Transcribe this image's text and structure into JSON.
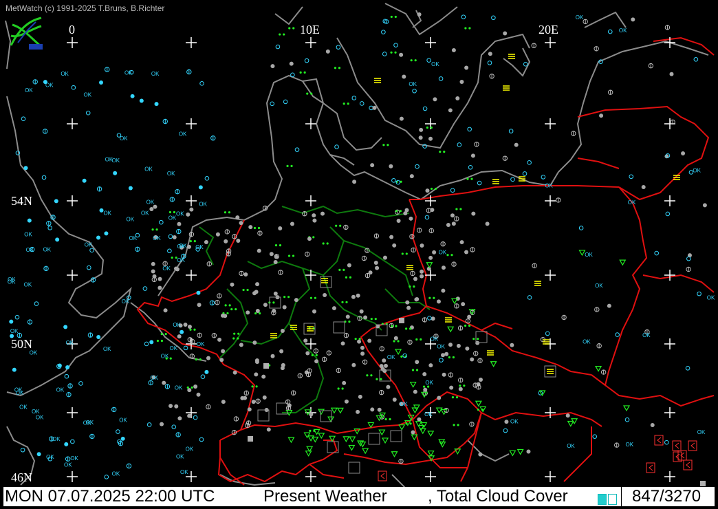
{
  "app": {
    "copyright": "MetWatch  (c) 1991-2025 T.Bruns, B.Richter"
  },
  "grid_labels": {
    "lon_0": "0",
    "lon_10e": "10E",
    "lon_20e": "20E",
    "lat_54n": "54N",
    "lat_50n": "50N",
    "lat_46n": "46N"
  },
  "status": {
    "datetime": "MON 07.07.2025 22:00 UTC",
    "product": "Present Weather",
    "overlay": ", Total Cloud Cover",
    "counter": "847/3270"
  },
  "colors": {
    "coast": "#8c8c8c",
    "border_national": "#e01010",
    "border_state": "#0e7a0e",
    "grid_cross": "#ffffff",
    "cloud_symbol": "#33d6ff",
    "overcast_symbol": "#a8a8a8",
    "rain_symbol": "#22ee22",
    "fog_symbol": "#ffff00",
    "thunder_symbol": "#ff3030"
  }
}
